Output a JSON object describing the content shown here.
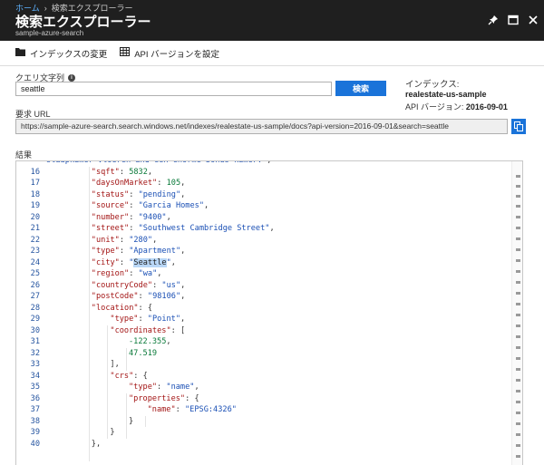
{
  "breadcrumb": {
    "home": "ホーム",
    "separator": "›",
    "current": "検索エクスプローラー"
  },
  "header": {
    "title": "検索エクスプローラー",
    "subtitle": "sample-azure-search"
  },
  "toolbar": {
    "change_index": "インデックスの変更",
    "set_api_version": "API バージョンを設定"
  },
  "query": {
    "label": "クエリ文字列",
    "value": "seattle",
    "search_button": "検索"
  },
  "index": {
    "label": "インデックス:",
    "name": "realestate-us-sample",
    "api_label": "API バージョン:",
    "api_version": "2016-09-01"
  },
  "request_url": {
    "label": "要求 URL",
    "value": "https://sample-azure-search.search.windows.net/indexes/realestate-us-sample/docs?api-version=2016-09-01&search=seattle"
  },
  "results": {
    "label": "結果",
    "lines": [
      {
        "n": "",
        "i": 0,
        "t": [
          [
            "s",
            "slaapkamer vloeren and een enorme bonus-kamer.\""
          ],
          [
            "p",
            ","
          ]
        ]
      },
      {
        "n": "16",
        "i": 3,
        "t": [
          [
            "k",
            "\"sqft\""
          ],
          [
            "p",
            ": "
          ],
          [
            "n",
            "5832"
          ],
          [
            "p",
            ","
          ]
        ]
      },
      {
        "n": "17",
        "i": 3,
        "t": [
          [
            "k",
            "\"daysOnMarket\""
          ],
          [
            "p",
            ": "
          ],
          [
            "n",
            "105"
          ],
          [
            "p",
            ","
          ]
        ]
      },
      {
        "n": "18",
        "i": 3,
        "t": [
          [
            "k",
            "\"status\""
          ],
          [
            "p",
            ": "
          ],
          [
            "s",
            "\"pending\""
          ],
          [
            "p",
            ","
          ]
        ]
      },
      {
        "n": "19",
        "i": 3,
        "t": [
          [
            "k",
            "\"source\""
          ],
          [
            "p",
            ": "
          ],
          [
            "s",
            "\"Garcia Homes\""
          ],
          [
            "p",
            ","
          ]
        ]
      },
      {
        "n": "20",
        "i": 3,
        "t": [
          [
            "k",
            "\"number\""
          ],
          [
            "p",
            ": "
          ],
          [
            "s",
            "\"9400\""
          ],
          [
            "p",
            ","
          ]
        ]
      },
      {
        "n": "21",
        "i": 3,
        "t": [
          [
            "k",
            "\"street\""
          ],
          [
            "p",
            ": "
          ],
          [
            "s",
            "\"Southwest Cambridge Street\""
          ],
          [
            "p",
            ","
          ]
        ]
      },
      {
        "n": "22",
        "i": 3,
        "t": [
          [
            "k",
            "\"unit\""
          ],
          [
            "p",
            ": "
          ],
          [
            "s",
            "\"280\""
          ],
          [
            "p",
            ","
          ]
        ]
      },
      {
        "n": "23",
        "i": 3,
        "t": [
          [
            "k",
            "\"type\""
          ],
          [
            "p",
            ": "
          ],
          [
            "s",
            "\"Apartment\""
          ],
          [
            "p",
            ","
          ]
        ]
      },
      {
        "n": "24",
        "i": 3,
        "t": [
          [
            "k",
            "\"city\""
          ],
          [
            "p",
            ": "
          ],
          [
            "s",
            "\""
          ],
          [
            "hl",
            "Seattle"
          ],
          [
            "s",
            "\""
          ],
          [
            "p",
            ","
          ]
        ]
      },
      {
        "n": "25",
        "i": 3,
        "t": [
          [
            "k",
            "\"region\""
          ],
          [
            "p",
            ": "
          ],
          [
            "s",
            "\"wa\""
          ],
          [
            "p",
            ","
          ]
        ]
      },
      {
        "n": "26",
        "i": 3,
        "t": [
          [
            "k",
            "\"countryCode\""
          ],
          [
            "p",
            ": "
          ],
          [
            "s",
            "\"us\""
          ],
          [
            "p",
            ","
          ]
        ]
      },
      {
        "n": "27",
        "i": 3,
        "t": [
          [
            "k",
            "\"postCode\""
          ],
          [
            "p",
            ": "
          ],
          [
            "s",
            "\"98106\""
          ],
          [
            "p",
            ","
          ]
        ]
      },
      {
        "n": "28",
        "i": 3,
        "t": [
          [
            "k",
            "\"location\""
          ],
          [
            "p",
            ": {"
          ]
        ]
      },
      {
        "n": "29",
        "i": 4,
        "t": [
          [
            "k",
            "\"type\""
          ],
          [
            "p",
            ": "
          ],
          [
            "s",
            "\"Point\""
          ],
          [
            "p",
            ","
          ]
        ]
      },
      {
        "n": "30",
        "i": 4,
        "t": [
          [
            "k",
            "\"coordinates\""
          ],
          [
            "p",
            ": ["
          ]
        ]
      },
      {
        "n": "31",
        "i": 5,
        "t": [
          [
            "n",
            "-122.355"
          ],
          [
            "p",
            ","
          ]
        ]
      },
      {
        "n": "32",
        "i": 5,
        "t": [
          [
            "n",
            "47.519"
          ]
        ]
      },
      {
        "n": "33",
        "i": 4,
        "t": [
          [
            "p",
            "],"
          ]
        ]
      },
      {
        "n": "34",
        "i": 4,
        "t": [
          [
            "k",
            "\"crs\""
          ],
          [
            "p",
            ": {"
          ]
        ]
      },
      {
        "n": "35",
        "i": 5,
        "t": [
          [
            "k",
            "\"type\""
          ],
          [
            "p",
            ": "
          ],
          [
            "s",
            "\"name\""
          ],
          [
            "p",
            ","
          ]
        ]
      },
      {
        "n": "36",
        "i": 5,
        "t": [
          [
            "k",
            "\"properties\""
          ],
          [
            "p",
            ": {"
          ]
        ]
      },
      {
        "n": "37",
        "i": 6,
        "t": [
          [
            "k",
            "\"name\""
          ],
          [
            "p",
            ": "
          ],
          [
            "s",
            "\"EPSG:4326\""
          ]
        ]
      },
      {
        "n": "38",
        "i": 5,
        "t": [
          [
            "p",
            "}"
          ]
        ]
      },
      {
        "n": "39",
        "i": 4,
        "t": [
          [
            "p",
            "}"
          ]
        ]
      },
      {
        "n": "40",
        "i": 3,
        "t": [
          [
            "p",
            "},"
          ]
        ]
      }
    ]
  },
  "icons": {
    "pin": "pin-icon",
    "maximize": "maximize-icon",
    "close": "close-icon",
    "folder": "folder-icon",
    "table": "table-icon",
    "info": "info-icon",
    "copy": "copy-icon"
  },
  "colors": {
    "header_bg": "#1f1f1f",
    "accent": "#1a73d9",
    "link": "#5fb3ff",
    "highlight": "#b9d7f7"
  }
}
